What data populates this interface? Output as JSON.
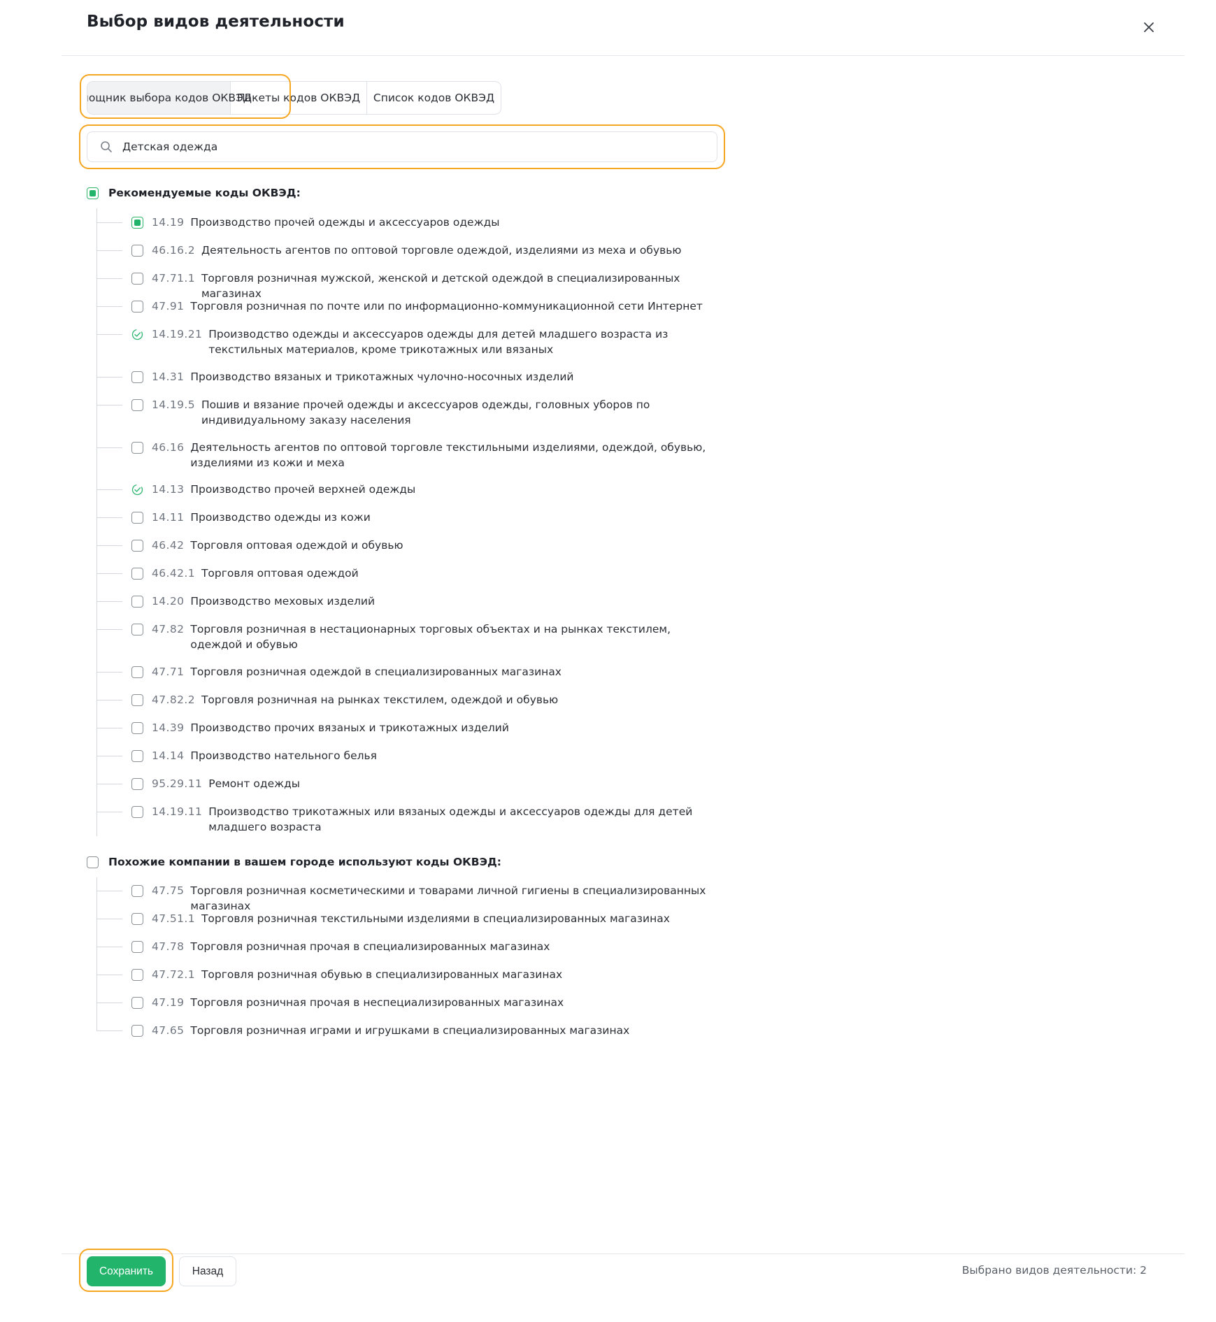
{
  "dialog": {
    "title": "Выбор видов деятельности"
  },
  "tabs": [
    {
      "label": "Помощник выбора кодов ОКВЭД",
      "active": true
    },
    {
      "label": "Пакеты кодов ОКВЭД",
      "active": false
    },
    {
      "label": "Список кодов ОКВЭД",
      "active": false
    }
  ],
  "search": {
    "value": "Детская одежда"
  },
  "groups": {
    "recommended": {
      "label": "Рекомендуемые коды ОКВЭД:",
      "state": "partial",
      "items": [
        {
          "code": "14.19",
          "name": "Производство прочей одежды и аксессуаров одежды",
          "state": "checked"
        },
        {
          "code": "46.16.2",
          "name": "Деятельность агентов по оптовой торговле одеждой, изделиями из меха и обувью",
          "state": "unchecked"
        },
        {
          "code": "47.71.1",
          "name": "Торговля розничная мужской, женской и детской одеждой в специализированных магазинах",
          "state": "unchecked"
        },
        {
          "code": "47.91",
          "name": "Торговля розничная по почте или по информационно-коммуникационной сети Интернет",
          "state": "unchecked"
        },
        {
          "code": "14.19.21",
          "name": "Производство одежды и аксессуаров одежды для детей младшего возраста из текстильных материалов, кроме трикотажных или вязаных",
          "state": "included"
        },
        {
          "code": "14.31",
          "name": "Производство вязаных и трикотажных чулочно-носочных изделий",
          "state": "unchecked"
        },
        {
          "code": "14.19.5",
          "name": "Пошив и вязание прочей одежды и аксессуаров одежды, головных уборов по индивидуальному заказу населения",
          "state": "unchecked"
        },
        {
          "code": "46.16",
          "name": "Деятельность агентов по оптовой торговле текстильными изделиями, одеждой, обувью, изделиями из кожи и меха",
          "state": "unchecked"
        },
        {
          "code": "14.13",
          "name": "Производство прочей верхней одежды",
          "state": "included"
        },
        {
          "code": "14.11",
          "name": "Производство одежды из кожи",
          "state": "unchecked"
        },
        {
          "code": "46.42",
          "name": "Торговля оптовая одеждой и обувью",
          "state": "unchecked"
        },
        {
          "code": "46.42.1",
          "name": "Торговля оптовая одеждой",
          "state": "unchecked"
        },
        {
          "code": "14.20",
          "name": "Производство меховых изделий",
          "state": "unchecked"
        },
        {
          "code": "47.82",
          "name": "Торговля розничная в нестационарных торговых объектах и на рынках текстилем, одеждой и обувью",
          "state": "unchecked"
        },
        {
          "code": "47.71",
          "name": "Торговля розничная одеждой в специализированных магазинах",
          "state": "unchecked"
        },
        {
          "code": "47.82.2",
          "name": "Торговля розничная на рынках текстилем, одеждой и обувью",
          "state": "unchecked"
        },
        {
          "code": "14.39",
          "name": "Производство прочих вязаных и трикотажных изделий",
          "state": "unchecked"
        },
        {
          "code": "14.14",
          "name": "Производство нательного белья",
          "state": "unchecked"
        },
        {
          "code": "95.29.11",
          "name": "Ремонт одежды",
          "state": "unchecked"
        },
        {
          "code": "14.19.11",
          "name": "Производство трикотажных или вязаных одежды и аксессуаров одежды для детей младшего возраста",
          "state": "unchecked"
        }
      ]
    },
    "similar": {
      "label": "Похожие компании в вашем городе используют коды ОКВЭД:",
      "state": "unchecked",
      "items": [
        {
          "code": "47.75",
          "name": "Торговля розничная косметическими и товарами личной гигиены в специализированных магазинах",
          "state": "unchecked"
        },
        {
          "code": "47.51.1",
          "name": "Торговля розничная текстильными изделиями в специализированных магазинах",
          "state": "unchecked"
        },
        {
          "code": "47.78",
          "name": "Торговля розничная прочая в специализированных магазинах",
          "state": "unchecked"
        },
        {
          "code": "47.72.1",
          "name": "Торговля розничная обувью в специализированных магазинах",
          "state": "unchecked"
        },
        {
          "code": "47.19",
          "name": "Торговля розничная прочая в неспециализированных магазинах",
          "state": "unchecked"
        },
        {
          "code": "47.65",
          "name": "Торговля розничная играми и игрушками в специализированных магазинах",
          "state": "unchecked"
        }
      ]
    }
  },
  "footer": {
    "save_label": "Сохранить",
    "back_label": "Назад",
    "selected_label": "Выбрано видов деятельности: 2"
  },
  "colors": {
    "accent": "#22b46b",
    "highlight": "#f5a623"
  },
  "icons": {
    "close": "close-icon",
    "search": "search-icon",
    "included": "check-circle-icon"
  }
}
